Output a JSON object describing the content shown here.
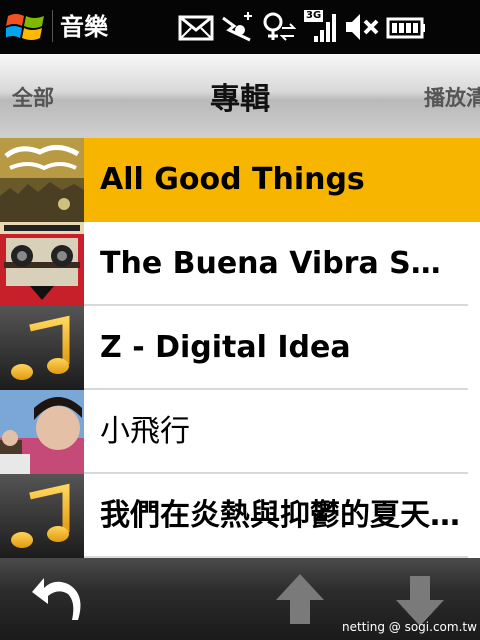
{
  "status_bar": {
    "app_title": "音樂",
    "network_label": "3G"
  },
  "category_bar": {
    "left": "全部",
    "center": "專輯",
    "right": "播放清"
  },
  "albums": [
    {
      "title": "All Good Things",
      "selected": true,
      "bold": true,
      "art": "pacha-massive-cover"
    },
    {
      "title": "The Buena Vibra Sound System",
      "selected": false,
      "bold": true,
      "art": "sidestepper-cover"
    },
    {
      "title": "Z - Digital Idea",
      "selected": false,
      "bold": true,
      "art": "music-note-placeholder"
    },
    {
      "title": "小飛行",
      "selected": false,
      "bold": false,
      "art": "photo-cover"
    },
    {
      "title": "我們在炎熱與抑鬱的夏天吻別",
      "selected": false,
      "bold": true,
      "art": "music-note-placeholder"
    }
  ],
  "bottom_bar": {
    "back_icon": "back-arrow-icon",
    "up_icon": "up-arrow-icon",
    "down_icon": "down-arrow-icon"
  },
  "watermark": "netting   @ sogi.com.tw",
  "colors": {
    "selected_row": "#f7b500",
    "note_icon": "#f2b21e"
  }
}
